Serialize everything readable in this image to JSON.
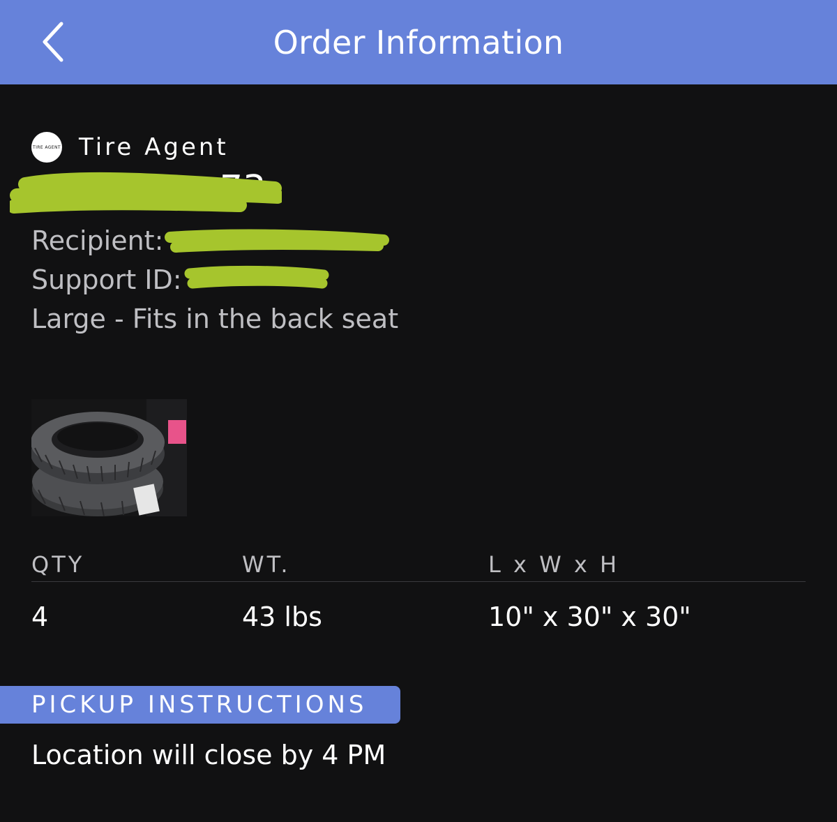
{
  "header": {
    "title": "Order Information",
    "back_icon": "chevron-left-icon"
  },
  "order": {
    "brand_logo_text": "TIRE AGENT",
    "brand_name": "Tire Agent",
    "number_visible_suffix": "73",
    "recipient_label": "Recipient:",
    "support_label": "Support ID:",
    "size_description": "Large - Fits in the back seat"
  },
  "specs": {
    "headers": {
      "qty": "QTY",
      "weight": "WT.",
      "dims": "L x W x H"
    },
    "values": {
      "qty": "4",
      "weight": "43 lbs",
      "dims": "10\" x 30\" x 30\""
    }
  },
  "pickup": {
    "heading": "PICKUP INSTRUCTIONS",
    "text": "Location will close by 4 PM"
  },
  "colors": {
    "header_bg": "#6682da",
    "page_bg": "#111112",
    "redaction": "#a6c52d",
    "secondary_text": "#bfbfc3"
  }
}
